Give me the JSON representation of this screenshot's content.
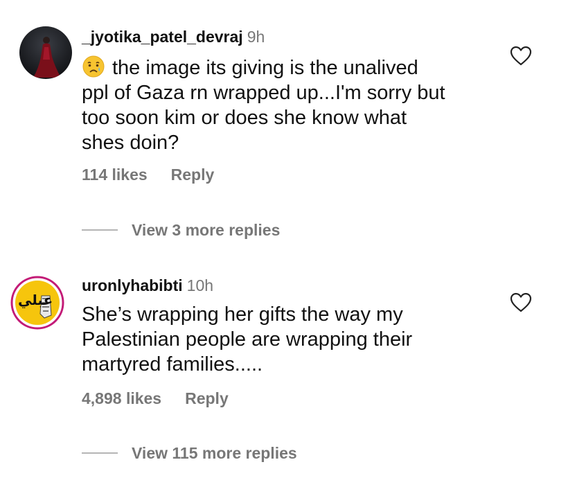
{
  "comments": [
    {
      "username": "_jyotika_patel_devraj",
      "time": "9h",
      "emoji": "crying-face-icon",
      "lines": [
        "the image its giving is the unalived",
        "ppl of Gaza rn wrapped up...I'm sorry but",
        "too soon kim or does she know what",
        "shes doin?"
      ],
      "likes": "114 likes",
      "reply_label": "Reply",
      "view_replies": "View 3 more replies"
    },
    {
      "username": "uronlyhabibti",
      "time": "10h",
      "avatar_text": "عبلي",
      "lines": [
        "She’s wrapping her gifts the way my",
        "Palestinian people are wrapping their",
        "martyred families....."
      ],
      "likes": "4,898 likes",
      "reply_label": "Reply",
      "view_replies": "View 115 more replies"
    }
  ],
  "colors": {
    "text": "#111111",
    "muted": "#777777",
    "avatar2_ring": "#c31b77",
    "avatar2_fill": "#f6c50d"
  }
}
